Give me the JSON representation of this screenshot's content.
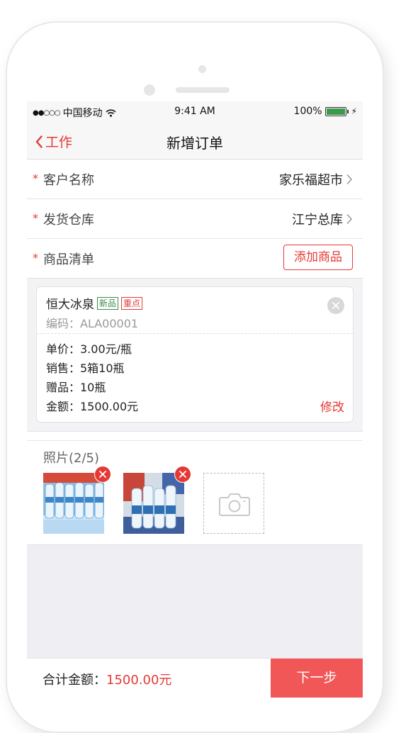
{
  "status_bar": {
    "carrier": "中国移动",
    "time": "9:41 AM",
    "battery": "100%"
  },
  "nav": {
    "back_label": "工作",
    "title": "新增订单"
  },
  "form": {
    "customer": {
      "label": "客户名称",
      "value": "家乐福超市"
    },
    "warehouse": {
      "label": "发货仓库",
      "value": "江宁总库"
    },
    "products": {
      "label": "商品清单",
      "add_button": "添加商品"
    }
  },
  "product": {
    "name": "恒大冰泉",
    "tags": [
      "新品",
      "重点"
    ],
    "code": "编码：ALA00001",
    "unit_price": "单价：3.00元/瓶",
    "sales": "销售：5箱10瓶",
    "gift": "赠品：10瓶",
    "amount": "金额：1500.00元",
    "edit_label": "修改"
  },
  "photos": {
    "title": "照片(2/5)",
    "count": 2,
    "max": 5
  },
  "footer": {
    "total_label": "合计金额：",
    "total_amount": "1500.00元",
    "next_button": "下一步"
  },
  "colors": {
    "accent": "#e53935",
    "next_button_bg": "#f25757",
    "new_tag": "#3c8a4a"
  }
}
